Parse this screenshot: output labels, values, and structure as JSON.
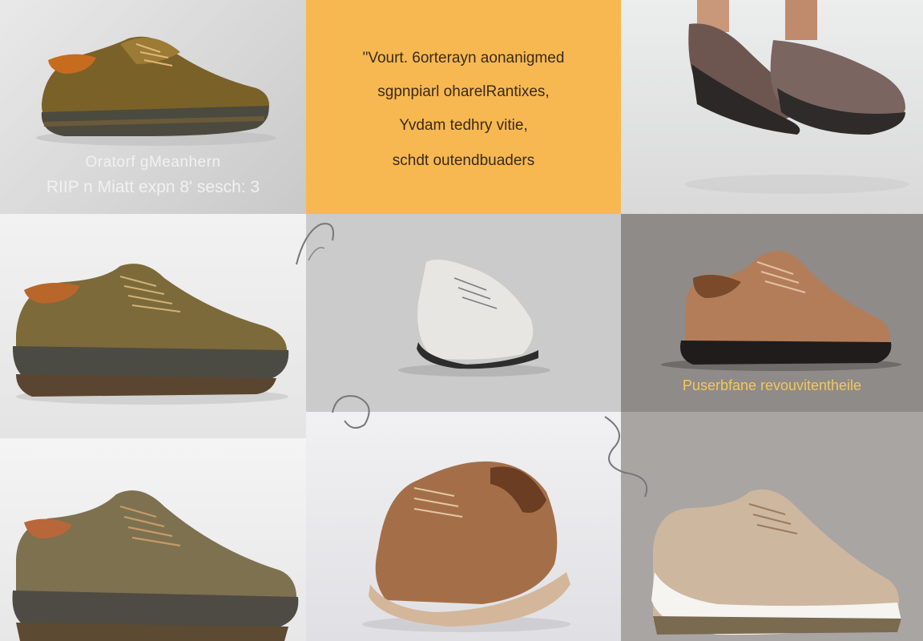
{
  "tiles": {
    "t1": {
      "caption_line1": "Oratorf gMeanhern",
      "caption_line2": "RIIP n Miatt expn 8' sesch: 3"
    },
    "t2": {
      "background": "#f7b851",
      "lines": [
        "\"Vourt. 6orterayn aonanigmed",
        "sgpnpiarl oharelRantixes,",
        "Yvdam tedhry vitie,",
        "schdt outendbuaders"
      ]
    },
    "t6": {
      "caption": "Puserbfane revouvitentheile"
    }
  },
  "icons": [
    "brown-low-top-shoe-icon",
    "woven-sandal-shoe-icon",
    "olive-casual-shoe-icon",
    "white-sneaker-icon",
    "tan-knit-shoe-icon",
    "olive-laced-shoe-icon",
    "brown-high-top-shoe-icon",
    "beige-knit-sneaker-icon"
  ],
  "colors": {
    "accent_caption": "#f2c85c",
    "panel_orange": "#f7b851"
  }
}
